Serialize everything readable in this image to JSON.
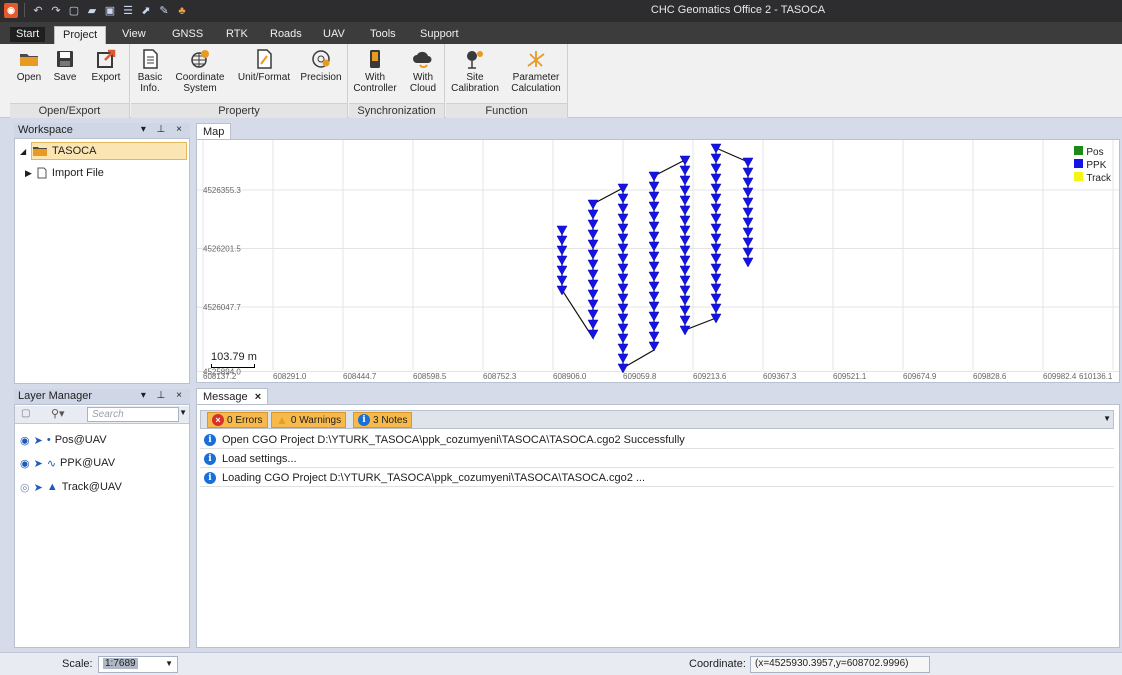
{
  "titlebar": {
    "title": "CHC Geomatics Office 2 - TASOCA"
  },
  "menu": {
    "start": "Start",
    "tabs": [
      "Project",
      "View",
      "GNSS",
      "RTK",
      "Roads",
      "UAV",
      "Tools",
      "Support"
    ]
  },
  "ribbon": {
    "open_export": {
      "label": "Open/Export",
      "open": "Open",
      "save": "Save",
      "export": "Export"
    },
    "property": {
      "label": "Property",
      "basic_info_1": "Basic",
      "basic_info_2": "Info.",
      "coord_1": "Coordinate",
      "coord_2": "System",
      "unit_format": "Unit/Format",
      "precision": "Precision"
    },
    "sync": {
      "label": "Synchronization",
      "controller_1": "With",
      "controller_2": "Controller",
      "cloud_1": "With",
      "cloud_2": "Cloud"
    },
    "function": {
      "label": "Function",
      "site_1": "Site",
      "site_2": "Calibration",
      "param_1": "Parameter",
      "param_2": "Calculation"
    }
  },
  "workspace": {
    "title": "Workspace",
    "controls": "▾ ⊥ ×",
    "project": "TASOCA",
    "import_file": "Import File"
  },
  "map": {
    "tab": "Map",
    "scale_bar": "103.79 m",
    "y_ticks": [
      "4526355.3",
      "4526201.5",
      "4526047.7",
      "4525894.0"
    ],
    "x_ticks": [
      "608137.2",
      "608291.0",
      "608444.7",
      "608598.5",
      "608752.3",
      "608906.0",
      "609059.8",
      "609213.6",
      "609367.3",
      "609521.1",
      "609674.9",
      "609828.6",
      "609982.4",
      "610136.1"
    ],
    "legend": [
      {
        "name": "Pos",
        "color": "#1a8a1a"
      },
      {
        "name": "PPK",
        "color": "#1414e6"
      },
      {
        "name": "Track",
        "color": "#f5f514"
      }
    ],
    "track_color": "#1414e6"
  },
  "layers": {
    "title": "Layer Manager",
    "controls": "▾ ⊥ ×",
    "search_placeholder": "Search",
    "items": [
      {
        "label": "Pos@UAV"
      },
      {
        "label": "PPK@UAV"
      },
      {
        "label": "Track@UAV"
      }
    ]
  },
  "messages": {
    "tab": "Message",
    "close": "×",
    "errors": "0 Errors",
    "warnings": "0 Warnings",
    "notes": "3 Notes",
    "rows": [
      "Open CGO Project D:\\YTURK_TASOCA\\ppk_cozumyeni\\TASOCA\\TASOCA.cgo2 Successfully",
      "Load settings...",
      "Loading CGO Project D:\\YTURK_TASOCA\\ppk_cozumyeni\\TASOCA\\TASOCA.cgo2 ..."
    ]
  },
  "status": {
    "scale_label": "Scale:",
    "scale_value": "1:7689",
    "coord_label": "Coordinate:",
    "coord_value": "(x=4525930.3957,y=608702.9996)"
  }
}
